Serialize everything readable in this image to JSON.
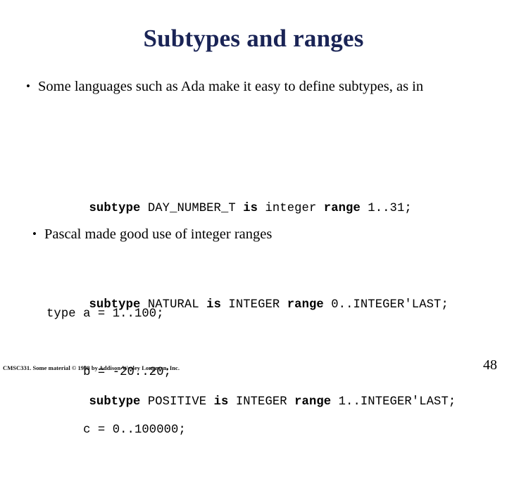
{
  "slide": {
    "title": "Subtypes and ranges",
    "title_color": "#1a2456",
    "background_color": "#ffffff",
    "page_number": "48",
    "footer": "CMSC331. Some material © 1998 by Addison Wesley Longman, Inc."
  },
  "bullets": [
    {
      "marker": "•",
      "text": "Some languages such as Ada make it easy to define subtypes, as in"
    },
    {
      "marker": "•",
      "text": "Pascal made good use of integer ranges"
    }
  ],
  "ada_code": {
    "lines": [
      {
        "segments": [
          {
            "text": "subtype ",
            "bold": true
          },
          {
            "text": "DAY_NUMBER_T ",
            "bold": false
          },
          {
            "text": "is ",
            "bold": true
          },
          {
            "text": "integer ",
            "bold": false
          },
          {
            "text": "range ",
            "bold": true
          },
          {
            "text": "1..31;",
            "bold": false
          }
        ],
        "plain": "subtype DAY_NUMBER_T is integer range 1..31;"
      },
      {
        "segments": [
          {
            "text": "subtype ",
            "bold": true
          },
          {
            "text": "NATURAL ",
            "bold": false
          },
          {
            "text": "is ",
            "bold": true
          },
          {
            "text": "INTEGER ",
            "bold": false
          },
          {
            "text": "range ",
            "bold": true
          },
          {
            "text": "0..INTEGER'LAST;",
            "bold": false
          }
        ],
        "plain": "subtype NATURAL is INTEGER range 0..INTEGER'LAST;"
      },
      {
        "segments": [
          {
            "text": "subtype ",
            "bold": true
          },
          {
            "text": "POSITIVE ",
            "bold": false
          },
          {
            "text": "is ",
            "bold": true
          },
          {
            "text": "INTEGER ",
            "bold": false
          },
          {
            "text": "range ",
            "bold": true
          },
          {
            "text": "1..INTEGER'LAST;",
            "bold": false
          }
        ],
        "plain": "subtype POSITIVE is INTEGER range 1..INTEGER'LAST;"
      }
    ]
  },
  "pascal_code": {
    "lines": [
      "type a = 1..100;",
      "     b = -20..20;",
      "     c = 0..100000;"
    ]
  }
}
